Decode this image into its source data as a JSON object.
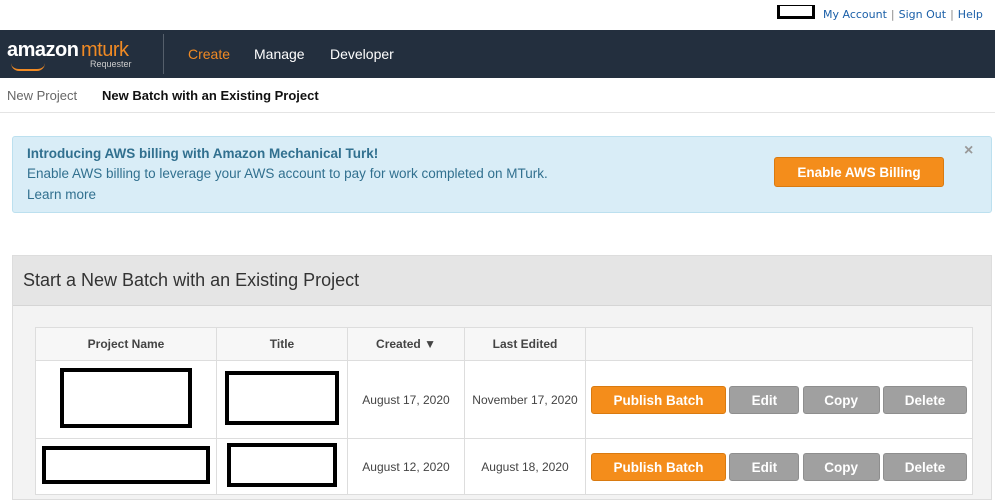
{
  "util": {
    "my_account": "My Account",
    "sign_out": "Sign Out",
    "help": "Help",
    "sep": "|"
  },
  "nav": {
    "logo_amazon": "amazon",
    "logo_mturk": "mturk",
    "logo_sub": "Requester",
    "items": [
      {
        "label": "Create",
        "active": true
      },
      {
        "label": "Manage",
        "active": false
      },
      {
        "label": "Developer",
        "active": false
      }
    ]
  },
  "breadcrumb": {
    "new_project": "New Project",
    "current": "New Batch with an Existing Project"
  },
  "alert": {
    "title": "Introducing AWS billing with Amazon Mechanical Turk!",
    "body": "Enable AWS billing to leverage your AWS account to pay for work completed on MTurk.",
    "learn_more": "Learn more",
    "button": "Enable AWS Billing",
    "close": "×"
  },
  "panel": {
    "title": "Start a New Batch with an Existing Project",
    "columns": {
      "project_name": "Project Name",
      "title": "Title",
      "created": "Created ▼",
      "last_edited": "Last Edited"
    },
    "rows": [
      {
        "created": "August 17, 2020",
        "last_edited": "November 17, 2020"
      },
      {
        "created": "August 12, 2020",
        "last_edited": "August 18, 2020"
      }
    ],
    "actions": {
      "publish": "Publish Batch",
      "edit": "Edit",
      "copy": "Copy",
      "delete": "Delete"
    }
  },
  "colors": {
    "nav_bg": "#232f3e",
    "accent_orange": "#f48d1b",
    "alert_bg": "#d9edf7",
    "alert_text": "#31708f",
    "link_blue": "#1a5fa8"
  }
}
